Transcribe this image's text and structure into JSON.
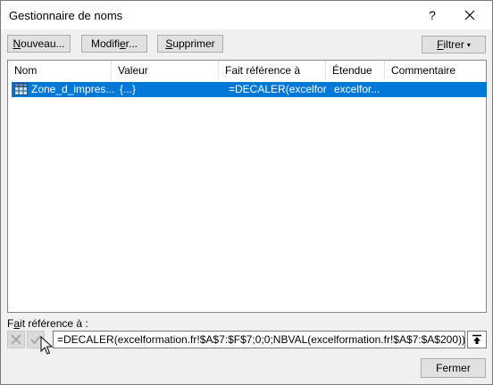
{
  "window": {
    "title": "Gestionnaire de noms",
    "help_label": "?"
  },
  "toolbar": {
    "new_label_u": "N",
    "new_label_rest": "ouveau...",
    "edit_label_pre": "Modifi",
    "edit_label_u": "e",
    "edit_label_rest": "r...",
    "delete_label_u": "S",
    "delete_label_rest": "upprimer",
    "filter_label_u": "F",
    "filter_label_rest": "iltrer",
    "filter_caret": "▾"
  },
  "table": {
    "columns": [
      "Nom",
      "Valeur",
      "Fait référence à",
      "Étendue",
      "Commentaire"
    ],
    "rows": [
      {
        "name": "Zone_d_impres...",
        "value": "{...}",
        "refers_to": "=DECALER(excelfor...",
        "scope": "excelfor...",
        "comment": ""
      }
    ]
  },
  "refers_to": {
    "label_u": "a",
    "label_pre": "F",
    "label_rest": "it référence à :",
    "value": "=DECALER(excelformation.fr!$A$7:$F$7;0;0;NBVAL(excelformation.fr!$A$7:$A$200))"
  },
  "footer": {
    "close_label": "Fermer"
  },
  "colors": {
    "selection": "#0078d7",
    "dialog_bg": "#f0f0f0",
    "button_bg": "#e1e1e1"
  }
}
